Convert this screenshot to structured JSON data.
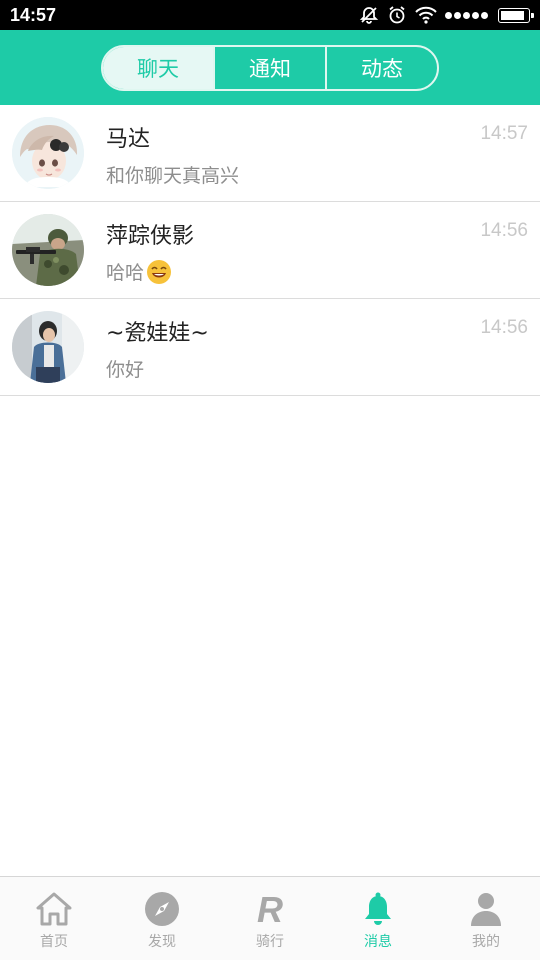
{
  "status_bar": {
    "time": "14:57",
    "battery_level": 0.9
  },
  "header": {
    "tabs": [
      {
        "label": "聊天",
        "active": true
      },
      {
        "label": "通知",
        "active": false
      },
      {
        "label": "动态",
        "active": false
      }
    ],
    "accent_color": "#1ecba7"
  },
  "chats": [
    {
      "name": "马达",
      "preview": "和你聊天真高兴",
      "time": "14:57",
      "avatar": "girl-illustration-avatar"
    },
    {
      "name": "萍踪侠影",
      "preview": "哈哈",
      "preview_emoji": "grinning-face-emoji",
      "time": "14:56",
      "avatar": "soldier-photo-avatar"
    },
    {
      "name": "~瓷娃娃~",
      "preview": "你好",
      "time": "14:56",
      "avatar": "person-photo-avatar"
    }
  ],
  "tabbar": {
    "items": [
      {
        "label": "首页",
        "icon": "home-icon",
        "active": false
      },
      {
        "label": "发现",
        "icon": "compass-icon",
        "active": false
      },
      {
        "label": "骑行",
        "icon": "ride-r-icon",
        "active": false
      },
      {
        "label": "消息",
        "icon": "bell-icon",
        "active": true
      },
      {
        "label": "我的",
        "icon": "user-icon",
        "active": false
      }
    ],
    "active_color": "#1ecba7",
    "inactive_color": "#a8a8a8"
  }
}
